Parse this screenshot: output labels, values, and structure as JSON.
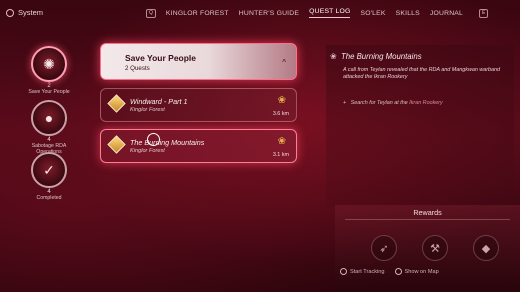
{
  "header": {
    "system_label": "System",
    "left_key": "Q",
    "right_key": "E",
    "tabs": [
      {
        "label": "KINGLOR FOREST"
      },
      {
        "label": "HUNTER'S GUIDE"
      },
      {
        "label": "QUEST LOG",
        "active": true
      },
      {
        "label": "SO'LEK"
      },
      {
        "label": "SKILLS"
      },
      {
        "label": "JOURNAL"
      }
    ]
  },
  "categories": [
    {
      "count": "2",
      "label": "Save Your People",
      "icon": "swirl-icon",
      "active": true
    },
    {
      "count": "4",
      "label": "Sabotage RDA Operations",
      "icon": "orb-icon",
      "active": false
    },
    {
      "count": "4",
      "label": "Completed",
      "icon": "checkmark-icon",
      "active": false
    }
  ],
  "quest_group": {
    "title": "Save Your People",
    "subtitle": "2 Quests",
    "chevron": "^"
  },
  "quests": [
    {
      "title": "Windward - Part 1",
      "region": "Kinglor Forest",
      "distance": "3.6 km",
      "selected": false
    },
    {
      "title": "The Burning Mountains",
      "region": "Kinglor Forest",
      "distance": "3.1 km",
      "selected": true
    }
  ],
  "detail": {
    "title": "The Burning Mountains",
    "description": "A call from Teylan revealed that the RDA and Mangkwan warband attacked the Ikran Rookery",
    "objective_prefix": "Search for Teylan at the",
    "objective_location": "Ikran Rookery"
  },
  "rewards": {
    "heading": "Rewards",
    "items": [
      "bow-icon",
      "crafting-icon",
      "material-icon"
    ]
  },
  "actions": [
    {
      "label": "Start Tracking"
    },
    {
      "label": "Show on Map"
    }
  ],
  "colors": {
    "accent": "#ff6f8a",
    "objective_highlight": "#d98a97",
    "quest_icon": "#e8b04a"
  }
}
